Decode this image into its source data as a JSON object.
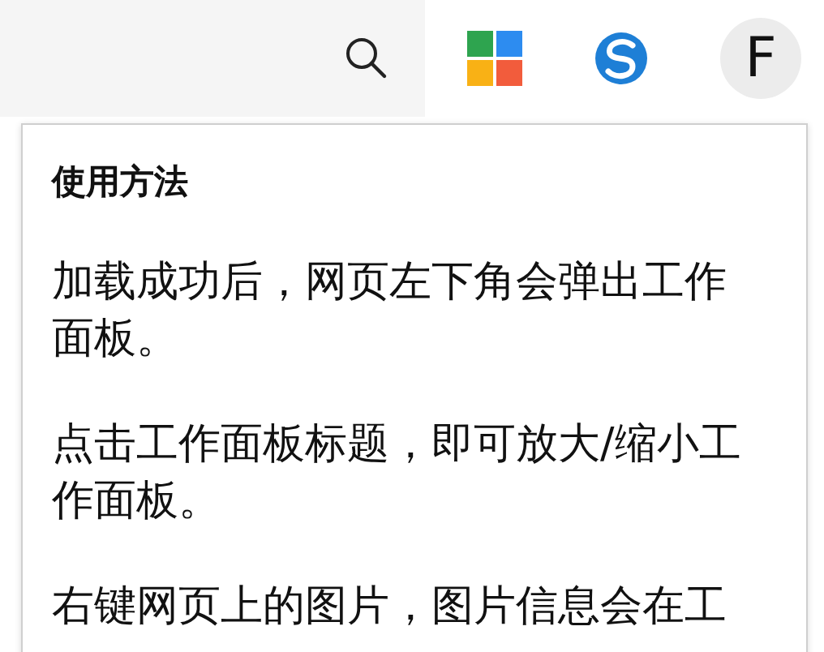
{
  "toolbar": {
    "avatar": "F"
  },
  "help_panel": {
    "title": "使用方法",
    "paragraphs": [
      "加载成功后，网页左下角会弹出工作面板。",
      "点击工作面板标题，即可放大/缩小工作面板。",
      "右键网页上的图片，图片信息会在工"
    ]
  }
}
